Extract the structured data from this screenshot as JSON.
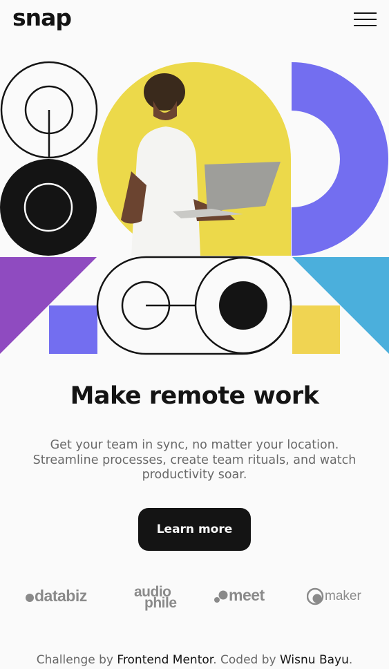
{
  "header": {
    "logo": "snap",
    "menu_icon": "hamburger-menu-icon"
  },
  "hero": {
    "image_alt": "Person typing on laptop",
    "colors": {
      "black": "#141414",
      "yellow": "#ECD94A",
      "purple": "#736EF0",
      "violet": "#8F4BC0",
      "cyan": "#4BAFDC",
      "pale_yellow": "#F0D452"
    }
  },
  "main": {
    "title": "Make remote work",
    "description": "Get your team in sync, no matter your location. Streamline processes, create team rituals, and watch productivity soar.",
    "cta_label": "Learn more"
  },
  "clients": {
    "databiz": "databiz",
    "audiophile_top": "audio",
    "audiophile_bottom": "phile",
    "meet": "meet",
    "maker": "maker"
  },
  "footer": {
    "prefix": "Challenge by ",
    "mentor_link": "Frontend Mentor",
    "middle": ". Coded by ",
    "author_link": "Wisnu Bayu",
    "suffix": "."
  }
}
